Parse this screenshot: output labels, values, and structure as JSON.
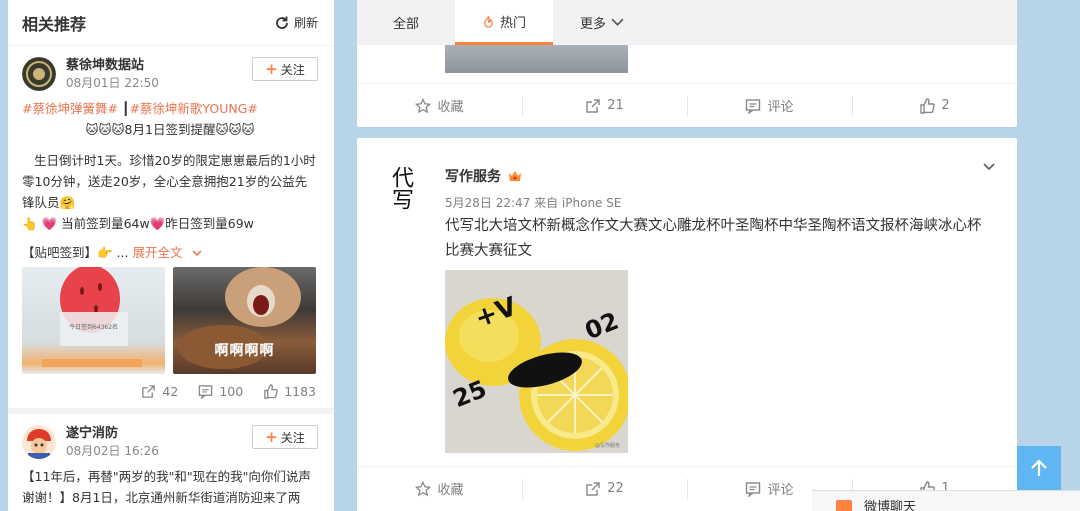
{
  "sidebar": {
    "title": "相关推荐",
    "refresh_label": "刷新",
    "follow_label": "关注",
    "posts": [
      {
        "name": "蔡徐坤数据站",
        "time": "08月01日 22:50",
        "tag1": "#蔡徐坤弹簧舞#",
        "sep": " ┃",
        "tag2": "#蔡徐坤新歌YOUNG#",
        "line2": "🐱🐱🐱8月1日签到提醒🐱🐱🐱",
        "line3": "生日倒计时1天。珍惜20岁的限定崽崽最后的1小时零10分钟，送走20岁，全心全意拥抱21岁的公益先锋队员🤗",
        "line4": "👆 💗 当前签到量64w💗昨日签到量69w",
        "line5_prefix": "【贴吧签到】👉 ... ",
        "expand": "展开全文",
        "thumb2_caption": "啊啊啊啊",
        "thumb1_caption": "今日签到64362名",
        "share": "42",
        "comment": "100",
        "like": "1183"
      },
      {
        "name": "遂宁消防",
        "time": "08月02日 16:26",
        "text": "【11年后，再替\"两岁的我\"和\"现在的我\"向你们说声谢谢！】8月1日，北京通州新华街道消防迎来了两"
      }
    ]
  },
  "main": {
    "tabs": [
      {
        "label": "全部"
      },
      {
        "label": "热门"
      },
      {
        "label": "更多"
      }
    ],
    "top_card_actions": {
      "collect": "收藏",
      "share": "21",
      "comment": "评论",
      "like": "2"
    },
    "post": {
      "author": "写作服务",
      "avatar_text": "代写",
      "time": "5月28日 22:47 来自 iPhone SE",
      "text": "代写北大培文杯新概念作文大赛文心雕龙杯叶圣陶杯中华圣陶杯语文报杯海峡冰心杯比赛大赛征文",
      "image_text_1": "+V",
      "image_text_2": "25",
      "image_text_3": "02",
      "watermark": "@写作服务",
      "actions": {
        "collect": "收藏",
        "share": "22",
        "comment": "评论",
        "like": "1"
      }
    }
  },
  "chat_label": "微博聊天",
  "colors": {
    "accent": "#ff8140",
    "link": "#eb7350",
    "page_bg": "#b8d4e8",
    "to_top": "#5fb6f2"
  }
}
